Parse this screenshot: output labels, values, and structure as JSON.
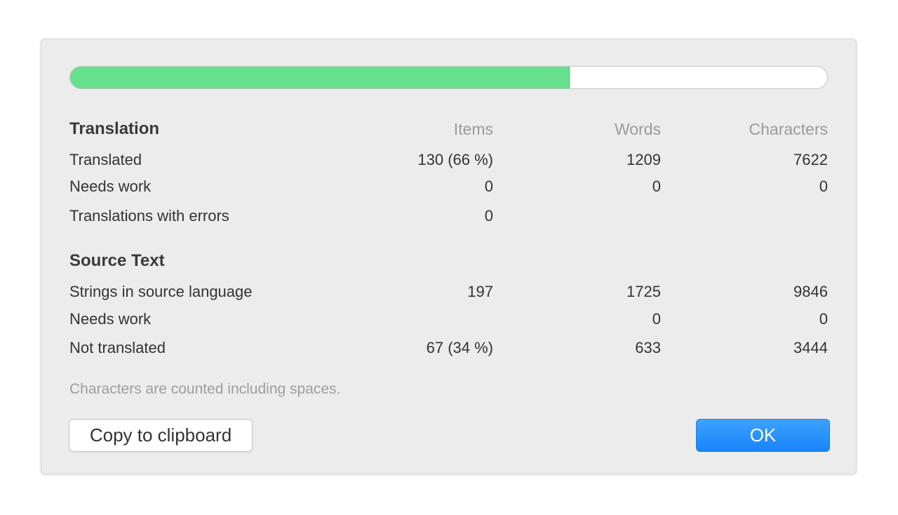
{
  "progress": {
    "translated_fraction": 0.66
  },
  "columns": {
    "items": "Items",
    "words": "Words",
    "characters": "Characters"
  },
  "translation": {
    "heading": "Translation",
    "rows": [
      {
        "label": "Translated",
        "items": "130 (66 %)",
        "words": "1209",
        "characters": "7622"
      },
      {
        "label": "Needs work",
        "items": "0",
        "words": "0",
        "characters": "0"
      },
      {
        "label": "Translations with errors",
        "items": "0",
        "words": "",
        "characters": ""
      }
    ]
  },
  "source_text": {
    "heading": "Source Text",
    "rows": [
      {
        "label": "Strings in source language",
        "items": "197",
        "words": "1725",
        "characters": "9846"
      },
      {
        "label": "Needs work",
        "items": "",
        "words": "0",
        "characters": "0"
      },
      {
        "label": "Not translated",
        "items": "67 (34 %)",
        "words": "633",
        "characters": "3444"
      }
    ]
  },
  "note": "Characters are counted including spaces.",
  "buttons": {
    "copy": "Copy to clipboard",
    "ok": "OK"
  },
  "colors": {
    "progress_fill": "#66e08c",
    "ok_button": "#1a84f9"
  }
}
